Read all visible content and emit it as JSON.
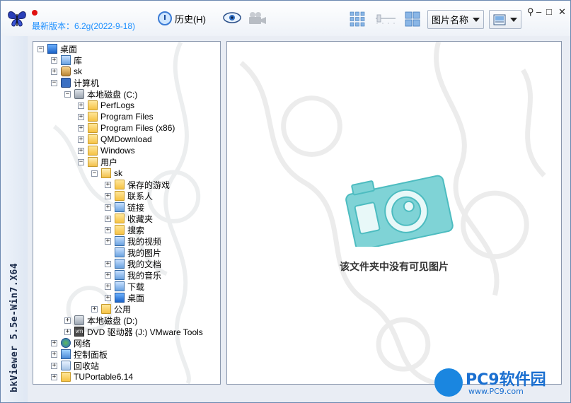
{
  "app": {
    "side_title": "bkViewer 5.5e-Win7.X64",
    "version": "最新版本：6.2g(2022-9-18)"
  },
  "toolbar": {
    "history_label": "历史(H)",
    "sort_select": "图片名称"
  },
  "window_controls": {
    "pin": "⚲",
    "minimize": "–",
    "restore": "□",
    "close": "✕"
  },
  "tree": {
    "nodes": [
      {
        "label": "桌面",
        "icon": "desktop-icon"
      },
      {
        "label": "库",
        "icon": "library-icon"
      },
      {
        "label": "sk",
        "icon": "user-icon"
      },
      {
        "label": "计算机",
        "icon": "computer-icon"
      },
      {
        "label": "本地磁盘 (C:)",
        "icon": "drive-icon"
      },
      {
        "label": "PerfLogs",
        "icon": "folder-icon"
      },
      {
        "label": "Program Files",
        "icon": "folder-icon"
      },
      {
        "label": "Program Files (x86)",
        "icon": "folder-icon"
      },
      {
        "label": "QMDownload",
        "icon": "folder-icon"
      },
      {
        "label": "Windows",
        "icon": "folder-icon"
      },
      {
        "label": "用户",
        "icon": "folder-icon"
      },
      {
        "label": "sk",
        "icon": "folder-icon"
      },
      {
        "label": "保存的游戏",
        "icon": "saved-games-icon"
      },
      {
        "label": "联系人",
        "icon": "contacts-icon"
      },
      {
        "label": "链接",
        "icon": "links-icon"
      },
      {
        "label": "收藏夹",
        "icon": "favorites-icon"
      },
      {
        "label": "搜索",
        "icon": "search-icon"
      },
      {
        "label": "我的视频",
        "icon": "videos-icon"
      },
      {
        "label": "我的图片",
        "icon": "pictures-icon"
      },
      {
        "label": "我的文档",
        "icon": "documents-icon"
      },
      {
        "label": "我的音乐",
        "icon": "music-icon"
      },
      {
        "label": "下载",
        "icon": "downloads-icon"
      },
      {
        "label": "桌面",
        "icon": "desktop-icon"
      },
      {
        "label": "公用",
        "icon": "folder-icon"
      },
      {
        "label": "本地磁盘 (D:)",
        "icon": "drive-icon"
      },
      {
        "label": "DVD 驱动器 (J:) VMware Tools",
        "icon": "dvd-icon"
      },
      {
        "label": "网络",
        "icon": "network-icon"
      },
      {
        "label": "控制面板",
        "icon": "control-panel-icon"
      },
      {
        "label": "回收站",
        "icon": "recycle-bin-icon"
      },
      {
        "label": "TUPortable6.14",
        "icon": "folder-icon"
      }
    ]
  },
  "viewer": {
    "empty_message": "该文件夹中没有可见图片"
  },
  "watermark": {
    "brand": "PC9软件园",
    "url": "www.PC9.com"
  }
}
